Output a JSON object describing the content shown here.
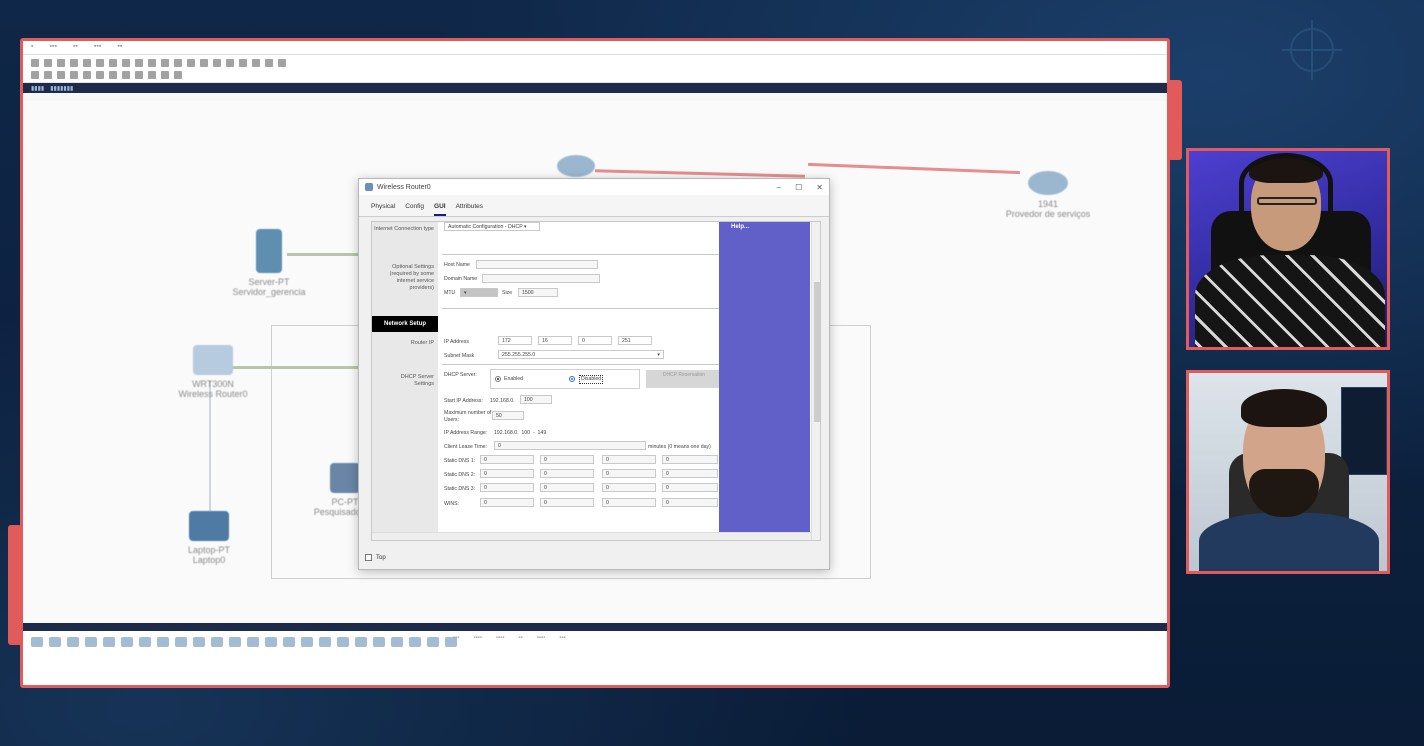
{
  "dialog": {
    "title": "Wireless Router0",
    "controls": [
      "–",
      "☐",
      "✕"
    ],
    "tabs": [
      {
        "label": "Physical"
      },
      {
        "label": "Config"
      },
      {
        "label": "GUI"
      },
      {
        "label": "Attributes"
      }
    ],
    "internet": {
      "label": "Internet Connection type",
      "value": "Automatic Configuration - DHCP"
    },
    "optional": {
      "label": "Optional Settings (required by some internet service providers)",
      "host_label": "Host Name",
      "domain_label": "Domain Name",
      "mtu_label": "MTU",
      "size_label": "Size",
      "size_value": "1500"
    },
    "network_setup": "Network Setup",
    "router_ip": {
      "label": "Router IP",
      "ip_label": "IP Address",
      "octets": [
        "172",
        "16",
        "0",
        "251"
      ],
      "mask_label": "Subnet Mask",
      "mask_value": "255.255.255.0"
    },
    "dhcp": {
      "label": "DHCP Server Settings",
      "server_label": "DHCP Server:",
      "enabled": "Enabled",
      "disabled": "Disabled",
      "reservation": "DHCP Reservation",
      "start_ip_label": "Start IP Address:",
      "start_ip_prefix": "192.168.0.",
      "start_ip_value": "100",
      "max_users_label": "Maximum number of Users:",
      "max_users_value": "50",
      "range_label": "IP Address Range:",
      "range_value": "192.168.0.  100  -  149",
      "lease_label": "Client Lease Time:",
      "lease_value": "0",
      "lease_note": "minutes (0 means one day)",
      "dns1_label": "Static DNS 1:",
      "dns2_label": "Static DNS 2:",
      "dns3_label": "Static DNS 3:",
      "wins_label": "WINS:",
      "zero": "0"
    },
    "help": "Help...",
    "top_label": "Top"
  },
  "workspace": {
    "devices": [
      {
        "label": "Server-PT\nServidor_gerencia"
      },
      {
        "label": "WRT300N\nWireless Router0"
      },
      {
        "label": "PC-PT\nPesquisador_..."
      },
      {
        "label": "Laptop-PT\nLaptop0"
      },
      {
        "label": "1941\nProvedor de serviços"
      }
    ]
  },
  "colors": {
    "frame": "#e25b5b",
    "help_bar": "#6060c8",
    "background": "#0d2140"
  }
}
